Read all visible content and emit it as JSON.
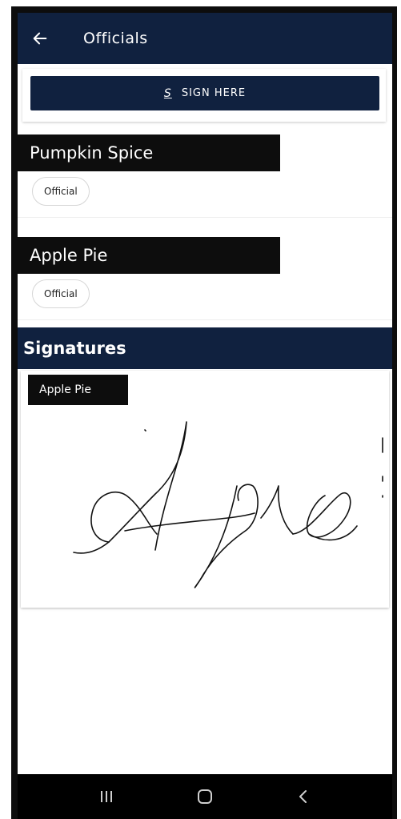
{
  "header": {
    "title": "Officials",
    "back_icon": "arrow-left-icon"
  },
  "sign": {
    "label": "SIGN HERE",
    "icon": "signature-icon"
  },
  "officials": [
    {
      "name": "Pumpkin Spice",
      "role": "Official"
    },
    {
      "name": "Apple Pie",
      "role": "Official"
    }
  ],
  "signatures": {
    "title": "Signatures",
    "items": [
      {
        "name": "Apple Pie"
      }
    ]
  },
  "nav": {
    "recents_icon": "recent-apps-icon",
    "home_icon": "home-icon",
    "back_icon": "back-chevron-icon"
  },
  "colors": {
    "primary": "#10213f",
    "label_bg": "#0d0d0d",
    "nav_bg": "#000000"
  }
}
